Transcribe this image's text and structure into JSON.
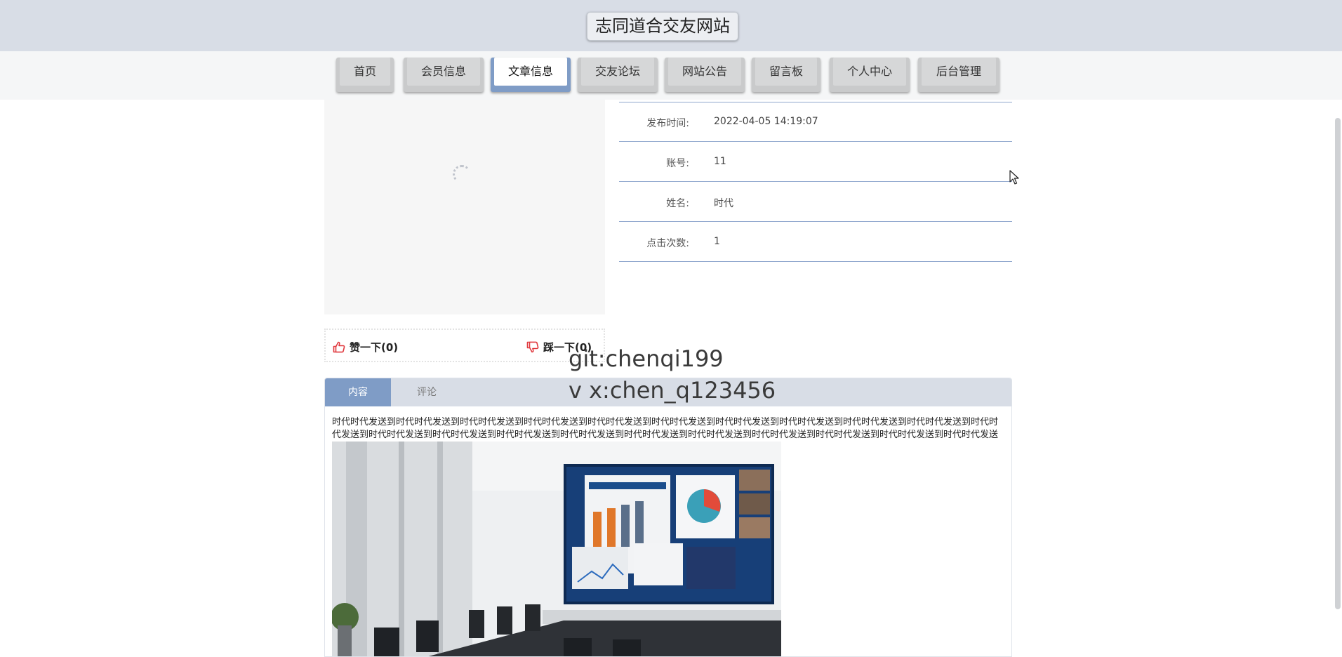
{
  "header": {
    "site_title": "志同道合交友网站"
  },
  "nav": {
    "items": [
      {
        "label": "首页",
        "active": false
      },
      {
        "label": "会员信息",
        "active": false
      },
      {
        "label": "文章信息",
        "active": true
      },
      {
        "label": "交友论坛",
        "active": false
      },
      {
        "label": "网站公告",
        "active": false
      },
      {
        "label": "留言板",
        "active": false
      },
      {
        "label": "个人中心",
        "active": false
      },
      {
        "label": "后台管理",
        "active": false
      }
    ]
  },
  "details": {
    "publish_time": {
      "label": "发布时间:",
      "value": "2022-04-05 14:19:07"
    },
    "account": {
      "label": "账号:",
      "value": "11"
    },
    "name": {
      "label": "姓名:",
      "value": "时代"
    },
    "clicks": {
      "label": "点击次数:",
      "value": "1"
    }
  },
  "votes": {
    "like": {
      "label": "赞一下(0)",
      "icon": "thumbs-up-icon"
    },
    "dislike": {
      "label": "踩一下(0)",
      "icon": "thumbs-down-icon"
    }
  },
  "watermark": {
    "line1": "git:chenqi199",
    "line2": "v x:chen_q123456"
  },
  "content": {
    "tabs": [
      {
        "label": "内容",
        "active": true
      },
      {
        "label": "评论",
        "active": false
      }
    ],
    "text": "时代时代发送到时代时代发送到时代时代发送到时代时代发送到时代时代发送到时代时代发送到时代时代发送到时代时代发送到时代时代发送到时代时代发送到时代时代发送到时代时代发送到时代时代发送到时代时代发送到时代时代发送到时代时代发送到时代时代发送到时代时代发送到时代时代发送到时代时代发送到时代时代发送到时代时代发送到时代时代发送到",
    "image": "conference-room-photo"
  },
  "colors": {
    "header_bg": "#d8dde6",
    "accent": "#7f9cc6",
    "divider": "#8ea6cd",
    "vote_icon": "#e0393e"
  }
}
